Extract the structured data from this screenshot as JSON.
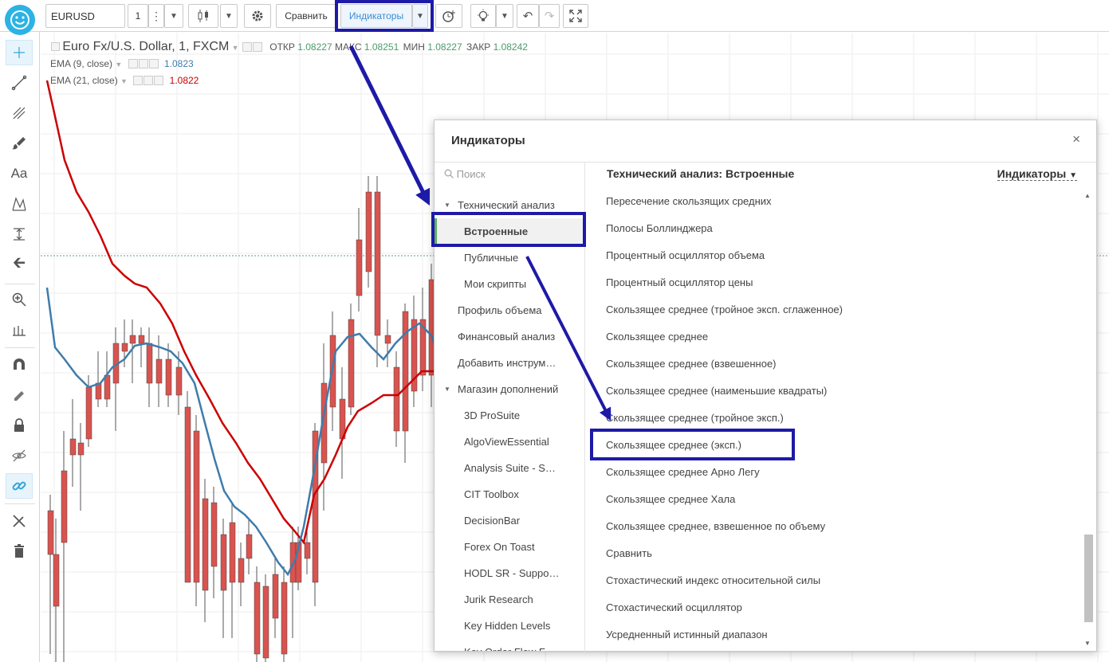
{
  "toolbar": {
    "symbol": "EURUSD",
    "interval": "1",
    "compare_label": "Сравнить",
    "indicators_label": "Индикаторы"
  },
  "legend": {
    "title": "Euro Fx/U.S. Dollar, 1, FXCM",
    "open_label": "ОТКР",
    "open_value": "1.08227",
    "high_label": "МАКС",
    "high_value": "1.08251",
    "low_label": "МИН",
    "low_value": "1.08227",
    "close_label": "ЗАКР",
    "close_value": "1.08242",
    "ema9_label": "EMA (9, close)",
    "ema9_value": "1.0823",
    "ema21_label": "EMA (21, close)",
    "ema21_value": "1.0822"
  },
  "dialog": {
    "title": "Индикаторы",
    "close_symbol": "×",
    "search_placeholder": "Поиск",
    "right_header": "Технический анализ: Встроенные",
    "right_dropdown": "Индикаторы",
    "left_menu": [
      {
        "label": "Технический анализ",
        "kind": "group"
      },
      {
        "label": "Встроенные",
        "kind": "sub",
        "selected": true
      },
      {
        "label": "Публичные",
        "kind": "sub"
      },
      {
        "label": "Мои скрипты",
        "kind": "sub"
      },
      {
        "label": "Профиль объема",
        "kind": "item"
      },
      {
        "label": "Финансовый анализ",
        "kind": "item"
      },
      {
        "label": "Добавить инструм…",
        "kind": "item"
      },
      {
        "label": "Магазин дополнений",
        "kind": "group"
      },
      {
        "label": "3D ProSuite",
        "kind": "sub"
      },
      {
        "label": "AlgoViewEssential",
        "kind": "sub"
      },
      {
        "label": "Analysis Suite - S…",
        "kind": "sub"
      },
      {
        "label": "CIT Toolbox",
        "kind": "sub"
      },
      {
        "label": "DecisionBar",
        "kind": "sub"
      },
      {
        "label": "Forex On Toast",
        "kind": "sub"
      },
      {
        "label": "HODL SR - Suppo…",
        "kind": "sub"
      },
      {
        "label": "Jurik Research",
        "kind": "sub"
      },
      {
        "label": "Key Hidden Levels",
        "kind": "sub"
      },
      {
        "label": "Key Order Flow F…",
        "kind": "sub"
      }
    ],
    "indicators": [
      "Пересечение скользящих средних",
      "Полосы Боллинджера",
      "Процентный осциллятор объема",
      "Процентный осциллятор цены",
      "Скользящее среднее (тройное эксп. сглаженное)",
      "Скользящее среднее",
      "Скользящее среднее (взвешенное)",
      "Скользящее среднее (наименьшие квадраты)",
      "Скользящее среднее (тройное эксп.)",
      "Скользящее среднее (эксп.)",
      "Скользящее среднее Арно Легу",
      "Скользящее среднее Хала",
      "Скользящее среднее, взвешенное по объему",
      "Сравнить",
      "Стохастический индекс относительной силы",
      "Стохастический осциллятор",
      "Усредненный истинный диапазон"
    ]
  },
  "colors": {
    "accent": "#1d1aa8",
    "up": "#5c9a70",
    "down": "#d9534f",
    "ema9": "#3f7cac",
    "ema21": "#cc0000",
    "selection": "#5ab15f"
  }
}
